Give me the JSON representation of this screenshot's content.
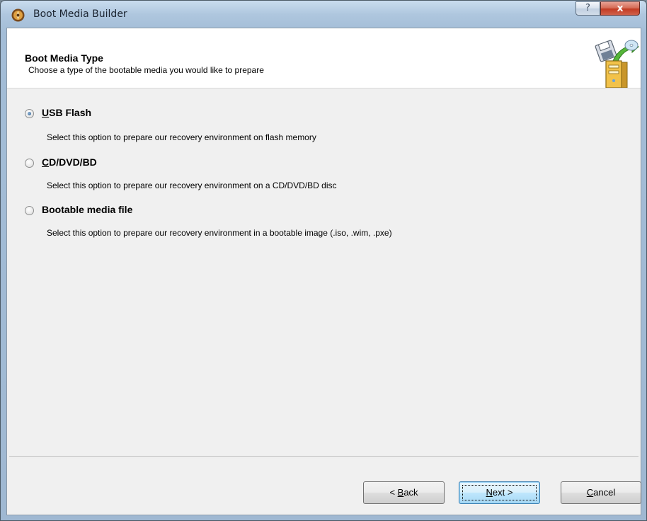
{
  "window": {
    "title": "Boot Media Builder",
    "help_glyph": "?",
    "close_glyph": "x"
  },
  "header": {
    "title": "Boot Media Type",
    "subtitle": "Choose a type of the bootable media you would like to prepare",
    "icon": "boot-media-wizard-icon"
  },
  "options": [
    {
      "label": "USB Flash",
      "mnemonic": "U",
      "label_rest": "SB Flash",
      "description": "Select this option to prepare our recovery environment on flash memory",
      "checked": true
    },
    {
      "label": "CD/DVD/BD",
      "mnemonic": "C",
      "label_rest": "D/DVD/BD",
      "description": "Select this option to prepare our recovery environment on a CD/DVD/BD disc",
      "checked": false
    },
    {
      "label": "Bootable media file",
      "description": "Select this option to prepare our recovery environment in a bootable image (.iso, .wim, .pxe)",
      "checked": false
    }
  ],
  "buttons": {
    "back": {
      "label": "< Back",
      "prefix": "< ",
      "mnemonic": "B",
      "rest": "ack"
    },
    "next": {
      "label": "Next >",
      "mnemonic": "N",
      "rest": "ext >"
    },
    "cancel": {
      "label": "Cancel",
      "mnemonic": "C",
      "rest": "ancel"
    }
  }
}
